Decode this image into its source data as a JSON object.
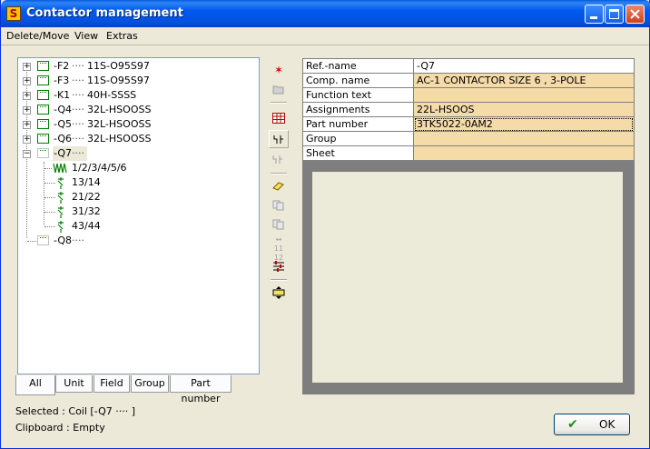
{
  "window": {
    "title": "Contactor management",
    "app_icon": "S"
  },
  "menu": [
    "Delete/Move",
    "View",
    "Extras"
  ],
  "tree": {
    "items": [
      {
        "ref": "-F2",
        "name": "11S-O95S97",
        "expanded": false
      },
      {
        "ref": "-F3",
        "name": "11S-O95S97",
        "expanded": false
      },
      {
        "ref": "-K1",
        "name": "40H-SSSS",
        "expanded": false
      },
      {
        "ref": "-Q4",
        "name": "32L-HSOOSS",
        "expanded": false
      },
      {
        "ref": "-Q5",
        "name": "32L-HSOOSS",
        "expanded": false
      },
      {
        "ref": "-Q6",
        "name": "32L-HSOOSS",
        "expanded": false
      },
      {
        "ref": "-Q7",
        "name": "",
        "expanded": true
      },
      {
        "ref": "-Q8",
        "name": "",
        "expanded": false
      }
    ],
    "q7_children": [
      "1/2/3/4/5/6",
      "13/14",
      "21/22",
      "31/32",
      "43/44"
    ],
    "dots": "····"
  },
  "tabs": [
    "All",
    "Unit",
    "Field",
    "Group",
    "Part number"
  ],
  "properties": [
    {
      "label": "Ref.-name",
      "value": "-Q7"
    },
    {
      "label": "Comp. name",
      "value": "AC-1 CONTACTOR SIZE 6 , 3-POLE"
    },
    {
      "label": "Function text",
      "value": ""
    },
    {
      "label": "Assignments",
      "value": "22L-HSOOS"
    },
    {
      "label": "Part number",
      "value": "3TK5022-0AM2"
    },
    {
      "label": "Group",
      "value": ""
    },
    {
      "label": "Sheet",
      "value": ""
    }
  ],
  "toolbar": {
    "icons": [
      "delete-icon",
      "open-folder-icon",
      "table-icon",
      "contact-icon",
      "contact-disabled-icon",
      "eraser-icon",
      "copy-icon",
      "paste-icon",
      "swap-icon",
      "settings-icon",
      "text-icon"
    ],
    "swap_label": "11 12"
  },
  "status": {
    "selected": "Selected : Coil [-Q7 ···· ]",
    "clipboard": "Clipboard : Empty"
  },
  "ok_button": {
    "label": "OK"
  },
  "colors": {
    "value_bg": "#f5dba7",
    "preview_frame": "#7e7e7e",
    "tree_icon": "#008000"
  }
}
